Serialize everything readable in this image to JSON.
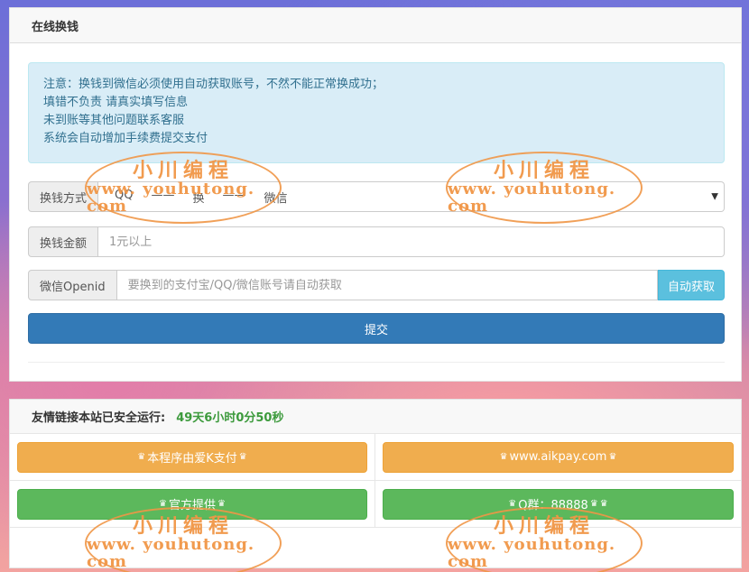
{
  "exchange_panel": {
    "title": "在线换钱",
    "notice_lines": [
      "注意：换钱到微信必须使用自动获取账号，不然不能正常换成功；",
      "填错不负责 请真实填写信息",
      "未到账等其他问题联系客服",
      "系统会自动增加手续费提交支付"
    ],
    "method": {
      "label": "换钱方式",
      "options": [
        "QQ",
        "换",
        "微信"
      ]
    },
    "amount": {
      "label": "换钱金额",
      "placeholder": "1元以上"
    },
    "openid": {
      "label": "微信Openid",
      "placeholder": "要换到的支付宝/QQ/微信账号请自动获取",
      "auto_button": "自动获取"
    },
    "submit_label": "提交"
  },
  "links_panel": {
    "heading": "友情链接本站已安全运行:",
    "uptime": "49天6小时0分50秒",
    "links": [
      {
        "label": "本程序由爱K支付",
        "style": "orange"
      },
      {
        "label": "www.aikpay.com",
        "style": "orange"
      },
      {
        "label": "官方提供",
        "style": "green"
      },
      {
        "label": "Q群：88888",
        "style": "green"
      }
    ]
  },
  "watermark": {
    "title": "小川编程",
    "url": "www. youhutong. com"
  },
  "colors": {
    "primary": "#337ab7",
    "info": "#5bc0de",
    "warning": "#f0ad4e",
    "success": "#5cb85c",
    "watermark": "#f0964a"
  }
}
